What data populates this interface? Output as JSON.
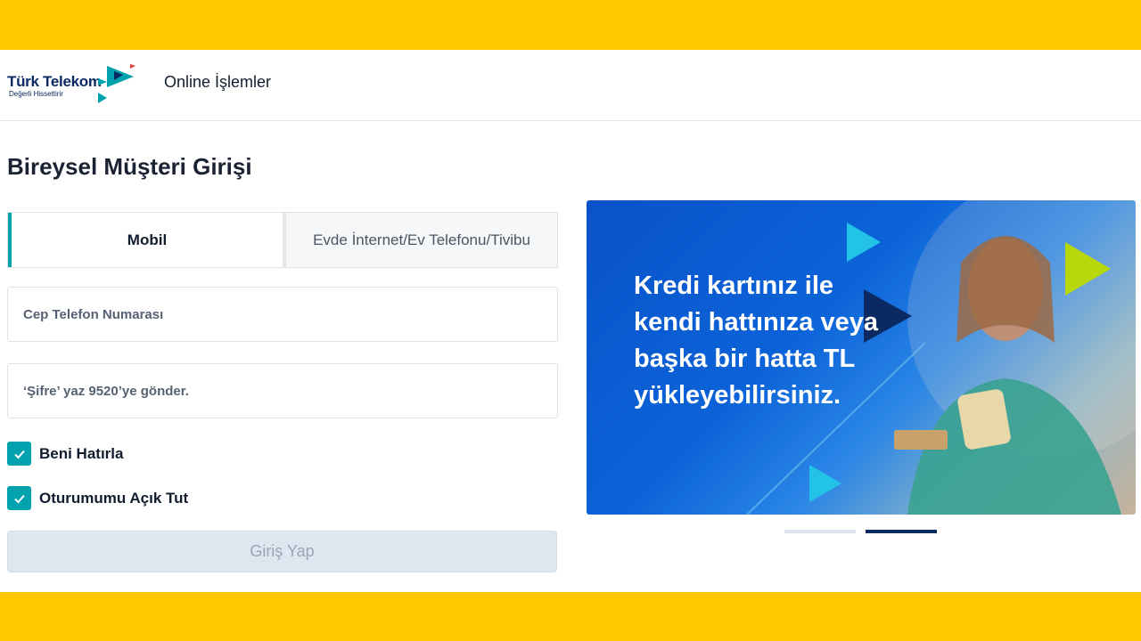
{
  "header": {
    "logo": {
      "name": "Türk Telekom",
      "tagline": "Değerli Hissettirir"
    },
    "nav_title": "Online İşlemler"
  },
  "page": {
    "title": "Bireysel Müşteri Girişi"
  },
  "tabs": [
    {
      "label": "Mobil",
      "active": true
    },
    {
      "label": "Evde İnternet/Ev Telefonu/Tivibu",
      "active": false
    }
  ],
  "form": {
    "phone": {
      "placeholder": "Cep Telefon Numarası",
      "value": ""
    },
    "password": {
      "placeholder": "‘Şifre’ yaz 9520’ye gönder.",
      "value": ""
    },
    "remember_me": {
      "label": "Beni Hatırla",
      "checked": true
    },
    "keep_logged_in": {
      "label": "Oturumumu Açık Tut",
      "checked": true
    },
    "submit_label": "Giriş Yap"
  },
  "banner": {
    "text": "Kredi kartınız ile kendi hattınıza veya başka bir hatta TL yükleyebilirsiniz.",
    "slides": 2,
    "active_slide": 2
  },
  "colors": {
    "brand_yellow": "#ffc800",
    "accent_teal": "#00a3ad",
    "navy": "#0b2a63",
    "banner_blue": "#0a52c9"
  },
  "icons": [
    "logo-arrows-icon",
    "check-icon",
    "play-triangle-icon"
  ]
}
